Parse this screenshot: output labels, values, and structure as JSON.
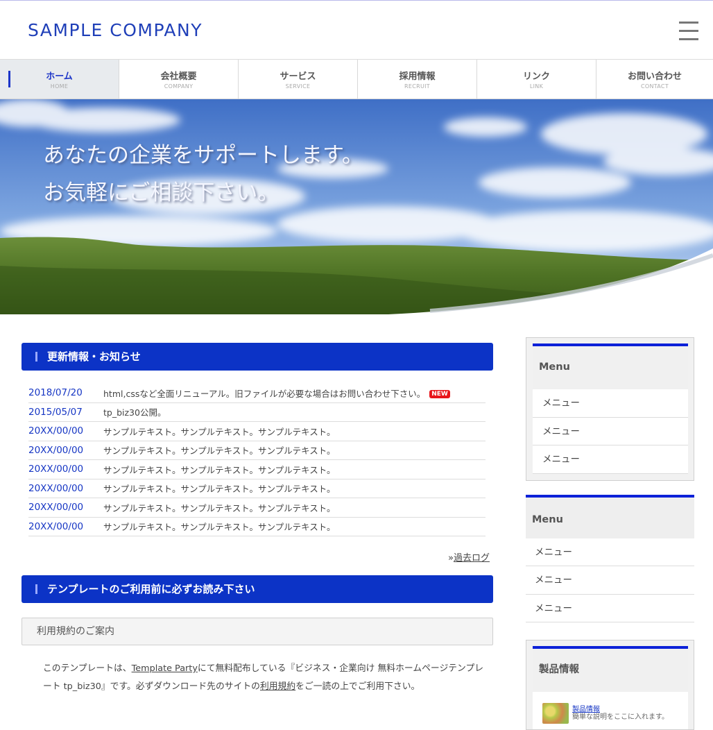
{
  "header": {
    "logo": "SAMPLE COMPANY"
  },
  "nav": [
    {
      "label": "ホーム",
      "sub": "HOME",
      "active": true
    },
    {
      "label": "会社概要",
      "sub": "COMPANY"
    },
    {
      "label": "サービス",
      "sub": "SERVICE"
    },
    {
      "label": "採用情報",
      "sub": "RECRUIT"
    },
    {
      "label": "リンク",
      "sub": "LINK"
    },
    {
      "label": "お問い合わせ",
      "sub": "CONTACT"
    }
  ],
  "hero": {
    "line1": "あなたの企業をサポートします。",
    "line2": "お気軽にご相談下さい。"
  },
  "news": {
    "heading": "更新情報・お知らせ",
    "badge": "NEW",
    "items": [
      {
        "date": "2018/07/20",
        "text": "html,cssなど全面リニューアル。旧ファイルが必要な場合はお問い合わせ下さい。"
      },
      {
        "date": "2015/05/07",
        "text": "tp_biz30公開。"
      },
      {
        "date": "20XX/00/00",
        "text": "サンプルテキスト。サンプルテキスト。サンプルテキスト。"
      },
      {
        "date": "20XX/00/00",
        "text": "サンプルテキスト。サンプルテキスト。サンプルテキスト。"
      },
      {
        "date": "20XX/00/00",
        "text": "サンプルテキスト。サンプルテキスト。サンプルテキスト。"
      },
      {
        "date": "20XX/00/00",
        "text": "サンプルテキスト。サンプルテキスト。サンプルテキスト。"
      },
      {
        "date": "20XX/00/00",
        "text": "サンプルテキスト。サンプルテキスト。サンプルテキスト。"
      },
      {
        "date": "20XX/00/00",
        "text": "サンプルテキスト。サンプルテキスト。サンプルテキスト。"
      }
    ],
    "past_log_prefix": "»",
    "past_log": "過去ログ"
  },
  "notice": {
    "heading": "テンプレートのご利用前に必ずお読み下さい",
    "subheading": "利用規約のご案内",
    "para_1": "このテンプレートは、",
    "link_template_party": "Template Party",
    "para_2": "にて無料配布している『ビジネス・企業向け 無料ホームページテンプレート tp_biz30』です。必ずダウンロード先のサイトの",
    "link_terms": "利用規約",
    "para_3": "をご一読の上でご利用下さい。"
  },
  "sidebar": {
    "box1": {
      "title": "Menu",
      "items": [
        "メニュー",
        "メニュー",
        "メニュー"
      ]
    },
    "box2": {
      "title": "Menu",
      "items": [
        "メニュー",
        "メニュー",
        "メニュー"
      ]
    },
    "box3": {
      "title": "製品情報",
      "product_title": "製品情報",
      "product_desc": "簡単な説明をここに入れます。"
    }
  },
  "colors": {
    "brand_blue": "#0c33c6",
    "logo_blue": "#1f3fb8",
    "link_blue": "#1636c4",
    "badge_red": "#e8141a"
  }
}
